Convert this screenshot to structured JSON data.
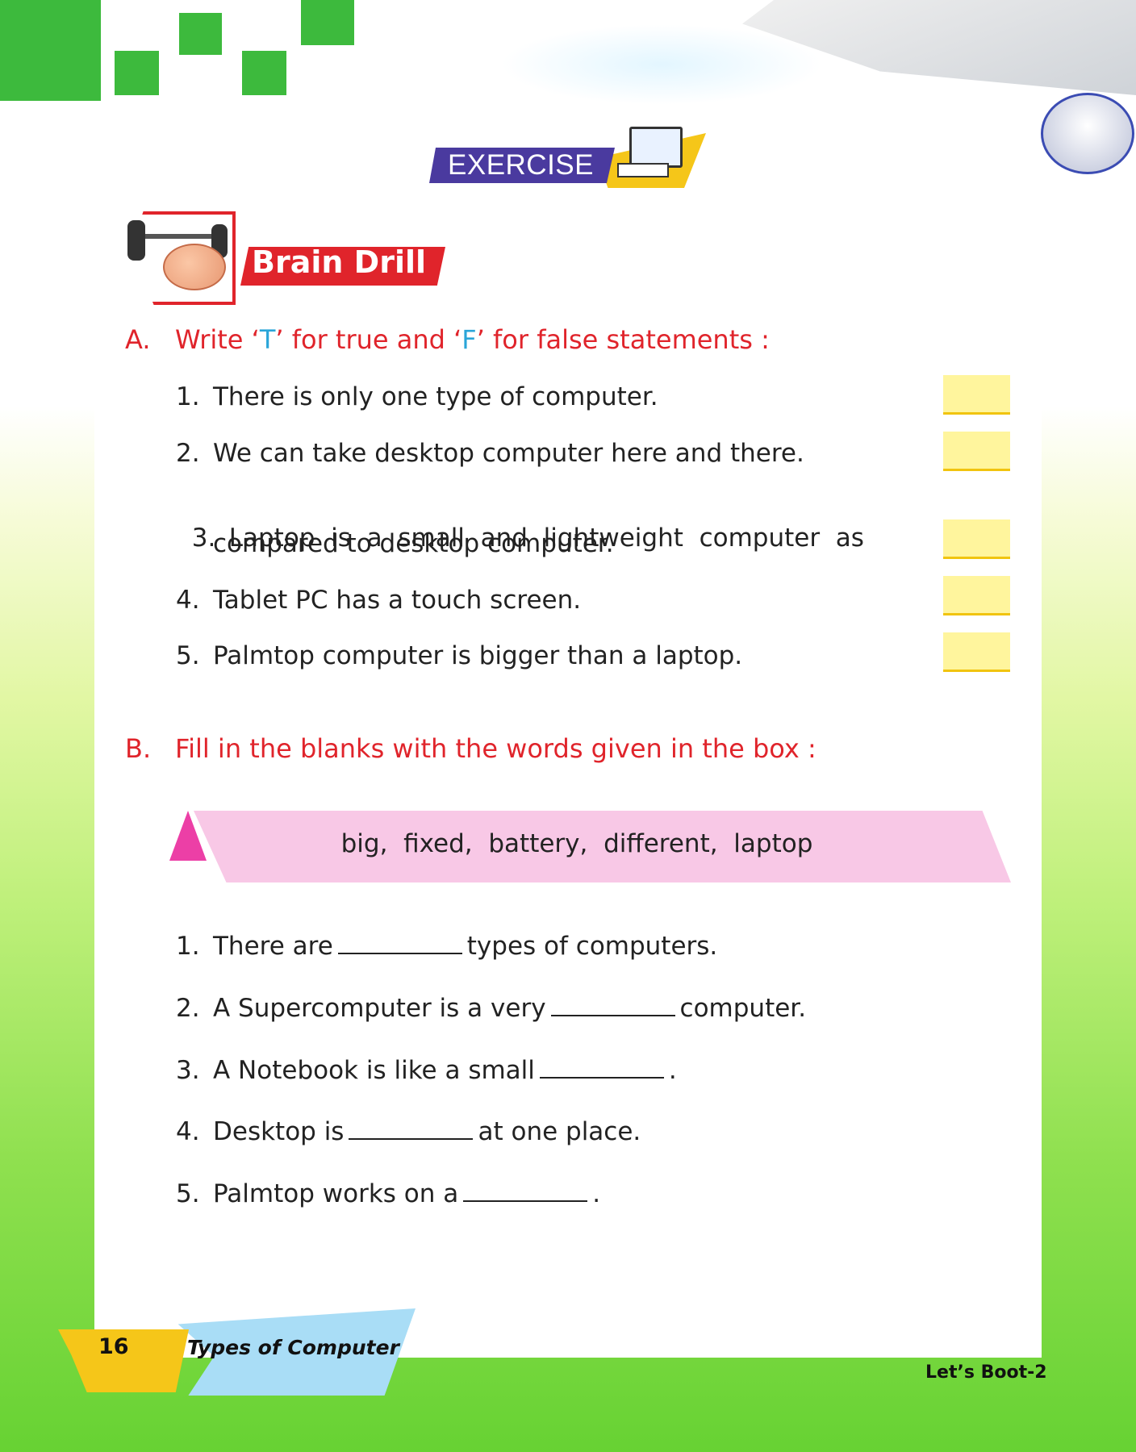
{
  "exercise_label": "EXERCISE",
  "brain_drill_label": "Brain Drill",
  "section_a": {
    "label": "A.",
    "instruction_pre": "Write ‘",
    "t": "T",
    "instruction_mid": "’ for true and ‘",
    "f": "F",
    "instruction_post": "’ for false statements :",
    "items": [
      {
        "num": "1.",
        "text": "There is only one type of computer."
      },
      {
        "num": "2.",
        "text": "We can take desktop computer here and there."
      },
      {
        "num": "3.",
        "text": "Laptop  is  a  small  and  lightweight  computer  as",
        "text2": "compared to desktop computer."
      },
      {
        "num": "4.",
        "text": "Tablet PC has a touch screen."
      },
      {
        "num": "5.",
        "text": "Palmtop computer is bigger than a laptop."
      }
    ]
  },
  "section_b": {
    "label": "B.",
    "instruction": "Fill in the blanks with the words given in the box :",
    "word_box": "big,  fixed,  battery,  different,  laptop",
    "items": [
      {
        "num": "1.",
        "before": "There are",
        "after": "types of computers."
      },
      {
        "num": "2.",
        "before": "A Supercomputer is a very",
        "after": "computer."
      },
      {
        "num": "3.",
        "before": "A Notebook is like a small",
        "after": "."
      },
      {
        "num": "4.",
        "before": "Desktop is",
        "after": "at one place."
      },
      {
        "num": "5.",
        "before": "Palmtop works on a",
        "after": "."
      }
    ]
  },
  "footer": {
    "page_number": "16",
    "chapter_title": "Types of Computer",
    "book_title": "Let’s Boot-2"
  },
  "colors": {
    "accent_red": "#e0242b",
    "green": "#3dba3d",
    "answer_box": "#fff59d"
  }
}
